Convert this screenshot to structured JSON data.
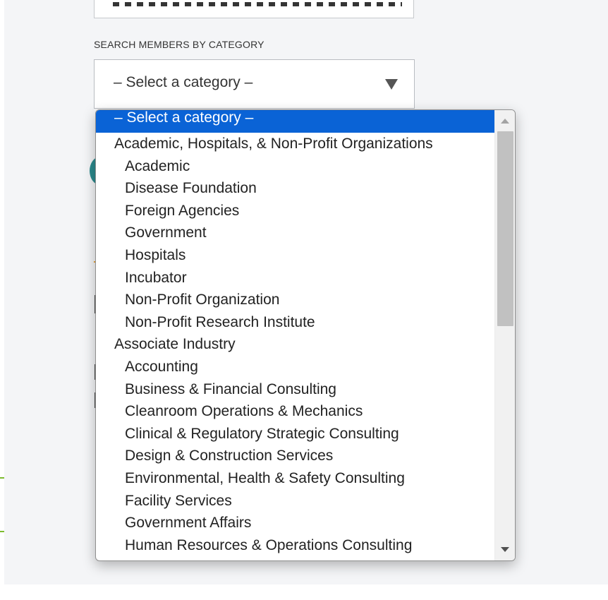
{
  "search": {
    "category_label": "SEARCH MEMBERS BY CATEGORY",
    "selected_value": "– Select a category –"
  },
  "dropdown": {
    "options": [
      {
        "label": "– Select a category –",
        "level": "group",
        "selected": true
      },
      {
        "label": "Academic, Hospitals, & Non-Profit Organizations",
        "level": "group",
        "selected": false
      },
      {
        "label": "Academic",
        "level": "child",
        "selected": false
      },
      {
        "label": "Disease Foundation",
        "level": "child",
        "selected": false
      },
      {
        "label": "Foreign Agencies",
        "level": "child",
        "selected": false
      },
      {
        "label": "Government",
        "level": "child",
        "selected": false
      },
      {
        "label": "Hospitals",
        "level": "child",
        "selected": false
      },
      {
        "label": "Incubator",
        "level": "child",
        "selected": false
      },
      {
        "label": "Non-Profit Organization",
        "level": "child",
        "selected": false
      },
      {
        "label": "Non-Profit Research Institute",
        "level": "child",
        "selected": false
      },
      {
        "label": "Associate Industry",
        "level": "group",
        "selected": false
      },
      {
        "label": "Accounting",
        "level": "child",
        "selected": false
      },
      {
        "label": "Business & Financial Consulting",
        "level": "child",
        "selected": false
      },
      {
        "label": "Cleanroom Operations & Mechanics",
        "level": "child",
        "selected": false
      },
      {
        "label": "Clinical & Regulatory Strategic Consulting",
        "level": "child",
        "selected": false
      },
      {
        "label": "Design & Construction Services",
        "level": "child",
        "selected": false
      },
      {
        "label": "Environmental, Health & Safety Consulting",
        "level": "child",
        "selected": false
      },
      {
        "label": "Facility Services",
        "level": "child",
        "selected": false
      },
      {
        "label": "Government Affairs",
        "level": "child",
        "selected": false
      },
      {
        "label": "Human Resources & Operations Consulting",
        "level": "child",
        "selected": false
      }
    ],
    "scroll_position": 0
  },
  "colors": {
    "selected_highlight": "#0a63d6",
    "page_background": "#f4f5f7",
    "accent_teal": "#2b8a8d",
    "accent_green": "#7dbb2f"
  }
}
